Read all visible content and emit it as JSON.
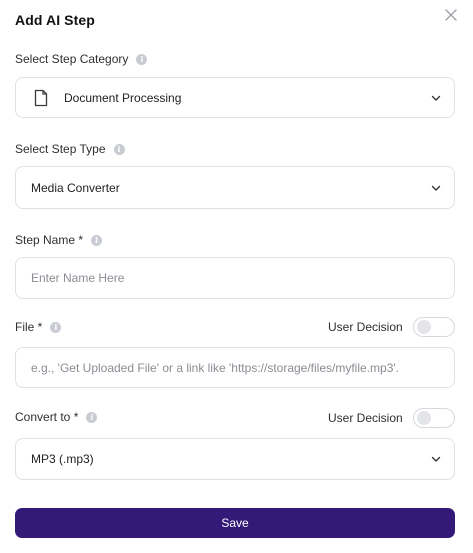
{
  "dialog": {
    "title": "Add AI Step",
    "close_icon": "close-icon"
  },
  "category": {
    "label": "Select Step Category",
    "selected": "Document Processing",
    "icon": "document-icon"
  },
  "step_type": {
    "label": "Select Step Type",
    "selected": "Media Converter"
  },
  "step_name": {
    "label": "Step Name *",
    "placeholder": "Enter Name Here",
    "value": ""
  },
  "file": {
    "label": "File *",
    "toggle_label": "User Decision",
    "toggle_on": false,
    "placeholder": "e.g., 'Get Uploaded File' or a link like 'https://storage/files/myfile.mp3'."
  },
  "convert_to": {
    "label": "Convert to *",
    "toggle_label": "User Decision",
    "toggle_on": false,
    "selected": "MP3 (.mp3)"
  },
  "actions": {
    "save_label": "Save"
  },
  "colors": {
    "primary": "#341a78",
    "border": "#dfe1e6",
    "info_icon": "#c9ccd3"
  }
}
